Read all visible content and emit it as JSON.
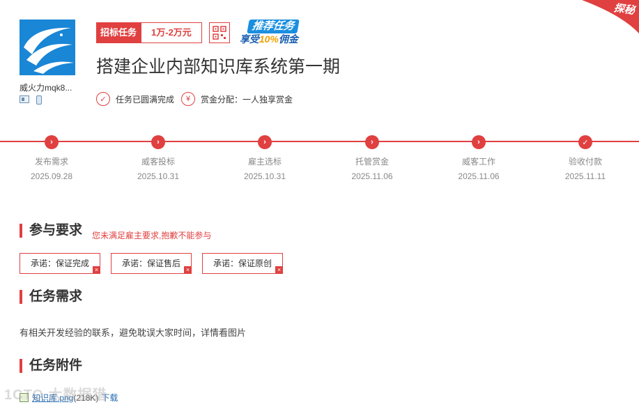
{
  "corner_badge": "探秘",
  "owner": {
    "name": "威火力mqk8..."
  },
  "task": {
    "type_tag": "招标任务",
    "amount": "1万-2万元",
    "promo_line1": "推荐任务",
    "promo_line2_prefix": "享受",
    "promo_line2_highlight": "10%",
    "promo_line2_suffix": "佣金",
    "title": "搭建企业内部知识库系统第一期",
    "status": "任务已圆满完成",
    "reward_rule": "赏金分配：一人独享赏金"
  },
  "steps": [
    {
      "name": "发布需求",
      "date": "2025.09.28",
      "icon": "chevron-right"
    },
    {
      "name": "威客投标",
      "date": "2025.10.31",
      "icon": "chevron-right"
    },
    {
      "name": "雇主选标",
      "date": "2025.10.31",
      "icon": "chevron-right"
    },
    {
      "name": "托管赏金",
      "date": "2025.11.06",
      "icon": "chevron-right"
    },
    {
      "name": "威客工作",
      "date": "2025.11.06",
      "icon": "chevron-right"
    },
    {
      "name": "验收付款",
      "date": "2025.11.11",
      "icon": "check"
    }
  ],
  "requirements": {
    "title": "参与要求",
    "warning": "您未满足雇主要求,抱歉不能参与",
    "promises": [
      "承诺：保证完成",
      "承诺：保证售后",
      "承诺：保证原创"
    ]
  },
  "needs": {
    "title": "任务需求",
    "text": "有相关开发经验的联系，避免耽误大家时间，详情看图片"
  },
  "attachments": {
    "title": "任务附件",
    "files": [
      {
        "name": "知识库.png",
        "size": "(218K)",
        "download": "下载"
      }
    ]
  },
  "watermark": "1CTO 大数据猎",
  "colors": {
    "accent": "#e04040",
    "link": "#2a6bb0",
    "logo_bg": "#1a86d6"
  }
}
